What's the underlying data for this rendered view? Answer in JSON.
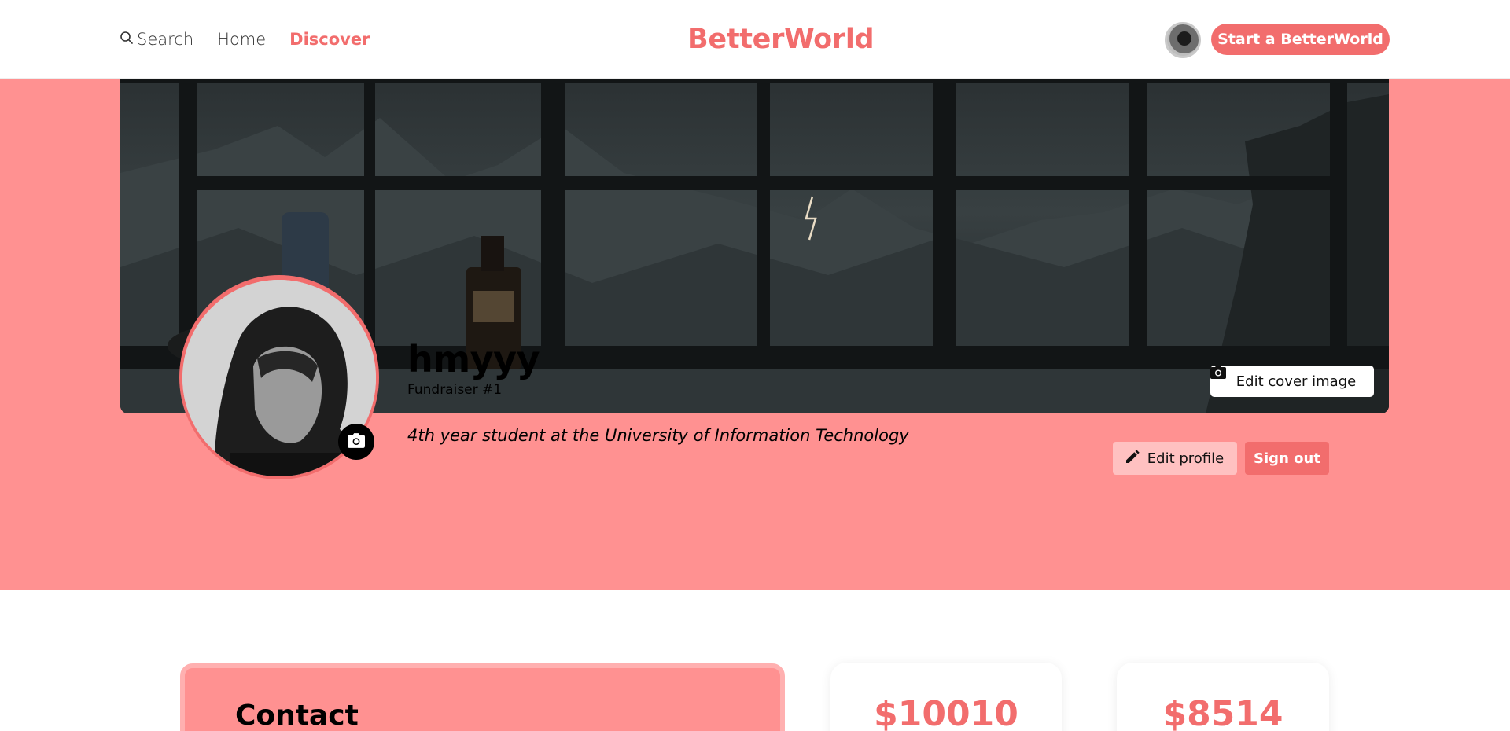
{
  "nav": {
    "search_label": "Search",
    "home_label": "Home",
    "discover_label": "Discover",
    "brand": "BetterWorld",
    "cta_label": "Start a BetterWorld"
  },
  "profile": {
    "edit_cover_label": "Edit cover image",
    "name": "hmyyy",
    "rank": "Fundraiser #1",
    "bio": "4th year student at the University of Information Technology",
    "edit_profile_label": "Edit profile",
    "sign_out_label": "Sign out"
  },
  "contact": {
    "title": "Contact"
  },
  "stats": [
    {
      "amount": "$10010"
    },
    {
      "amount": "$8514"
    }
  ],
  "colors": {
    "accent": "#f26d6d",
    "hero_bg": "#ff9191",
    "soft_button": "#ffc1c1"
  },
  "icons": {
    "search": "search-icon",
    "camera": "camera-icon",
    "pencil": "pencil-icon"
  }
}
